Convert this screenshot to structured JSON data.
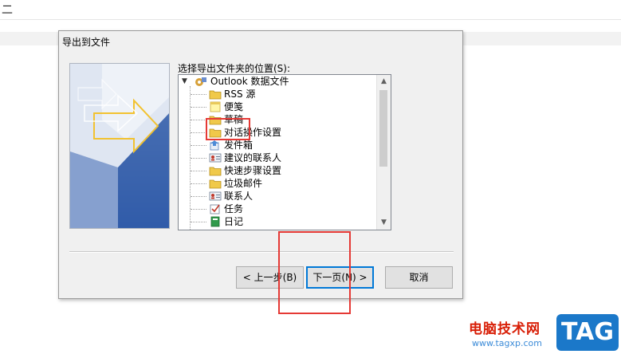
{
  "background": {
    "top_glyph": "二"
  },
  "dialog": {
    "title": "导出到文件",
    "tree_label": "选择导出文件夹的位置(S):",
    "tree": {
      "root": "Outlook 数据文件",
      "items": [
        {
          "label": "RSS 源",
          "icon": "folder-icon"
        },
        {
          "label": "便笺",
          "icon": "sticky-note-icon"
        },
        {
          "label": "草稿",
          "icon": "folder-icon"
        },
        {
          "label": "对话操作设置",
          "icon": "folder-icon"
        },
        {
          "label": "发件箱",
          "icon": "outbox-icon"
        },
        {
          "label": "建议的联系人",
          "icon": "contact-card-icon"
        },
        {
          "label": "快速步骤设置",
          "icon": "folder-icon"
        },
        {
          "label": "垃圾邮件",
          "icon": "folder-icon"
        },
        {
          "label": "联系人",
          "icon": "contact-card-icon"
        },
        {
          "label": "任务",
          "icon": "task-icon"
        },
        {
          "label": "日记",
          "icon": "journal-icon"
        }
      ]
    },
    "buttons": {
      "back": "< 上一步(B)",
      "next": "下一页(N) >",
      "cancel": "取消"
    }
  },
  "watermark": {
    "text": "电脑技术网",
    "url": "www.tagxp.com",
    "logo": "TAG"
  },
  "colors": {
    "highlight_box": "#e53935",
    "dialog_bg": "#f0f0f0",
    "default_button_border": "#0078d7",
    "watermark_red": "#d81e06",
    "watermark_blue": "#1b78c9"
  }
}
